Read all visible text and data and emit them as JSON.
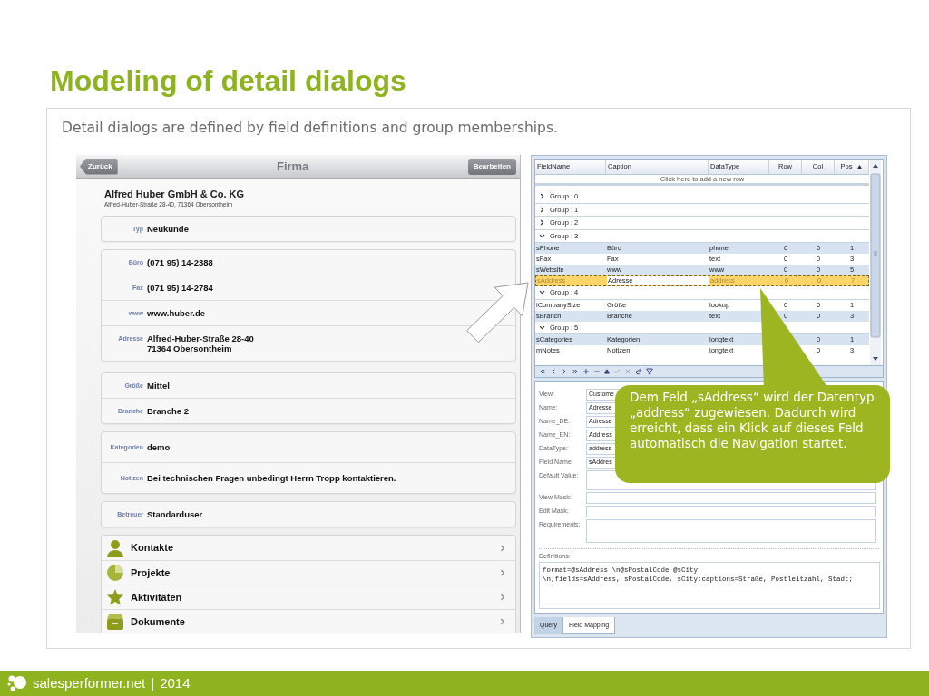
{
  "slide": {
    "title": "Modeling of detail dialogs",
    "subtitle": "Detail dialogs are defined by field definitions and group memberships."
  },
  "mobile": {
    "back": "Zurück",
    "title": "Firma",
    "edit": "Bearbeiten",
    "company": "Alfred Huber GmbH & Co. KG",
    "address": "Alfred-Huber-Straße 28-40, 71364 Obersontheim",
    "groups": [
      [
        {
          "label": "Typ",
          "value": "Neukunde"
        }
      ],
      [
        {
          "label": "Büro",
          "value": "(071 95) 14-2388"
        },
        {
          "label": "Fax",
          "value": "(071 95) 14-2784"
        },
        {
          "label": "www",
          "value": "www.huber.de"
        },
        {
          "label": "Adresse",
          "value": "Alfred-Huber-Straße 28-40\n71364 Obersontheim"
        }
      ],
      [
        {
          "label": "Größe",
          "value": "Mittel"
        },
        {
          "label": "Branche",
          "value": "Branche 2"
        }
      ],
      [
        {
          "label": "Kategorien",
          "value": "demo"
        },
        {
          "label": "Notizen",
          "value": "Bei technischen Fragen unbedingt Herrn Tropp kontaktieren."
        }
      ],
      [
        {
          "label": "Betreuer",
          "value": "Standarduser"
        }
      ]
    ],
    "links": [
      {
        "label": "Kontakte",
        "kind": "contacts"
      },
      {
        "label": "Projekte",
        "kind": "projects"
      },
      {
        "label": "Aktivitäten",
        "kind": "activities"
      },
      {
        "label": "Dokumente",
        "kind": "documents"
      }
    ]
  },
  "grid": {
    "columns": [
      {
        "label": "FieldName",
        "sorted": false
      },
      {
        "label": "Caption",
        "sorted": false
      },
      {
        "label": "DataType",
        "sorted": false
      },
      {
        "label": "Row",
        "sorted": false
      },
      {
        "label": "Col",
        "sorted": false
      },
      {
        "label": "Pos",
        "sorted": true
      }
    ],
    "new_row": "Click here to add a new row",
    "groups": [
      {
        "label": "Group : 0",
        "expanded": false
      },
      {
        "label": "Group : 1",
        "expanded": false
      },
      {
        "label": "Group : 2",
        "expanded": false
      },
      {
        "label": "Group : 3",
        "expanded": true,
        "children": [
          {
            "cells": [
              "sPhone",
              "Büro",
              "phone",
              "0",
              "0",
              "1"
            ],
            "shaded": true,
            "selected": false
          },
          {
            "cells": [
              "sFax",
              "Fax",
              "text",
              "0",
              "0",
              "3"
            ],
            "shaded": false,
            "selected": false
          },
          {
            "cells": [
              "sWebsite",
              "www",
              "www",
              "0",
              "0",
              "5"
            ],
            "shaded": true,
            "selected": false
          },
          {
            "cells": [
              "sAddress",
              "Adresse",
              "address",
              "0",
              "0",
              "7"
            ],
            "shaded": false,
            "selected": true
          }
        ]
      },
      {
        "label": "Group : 4",
        "expanded": true,
        "children": [
          {
            "cells": [
              "iCompanySize",
              "Größe",
              "lookup",
              "0",
              "0",
              "1"
            ],
            "shaded": false,
            "selected": false
          },
          {
            "cells": [
              "sBranch",
              "Branche",
              "text",
              "0",
              "0",
              "3"
            ],
            "shaded": true,
            "selected": false
          }
        ]
      },
      {
        "label": "Group : 5",
        "expanded": true,
        "children": [
          {
            "cells": [
              "sCategories",
              "Kategorien",
              "longtext",
              null,
              "0",
              "1"
            ],
            "shaded": true,
            "selected": false
          },
          {
            "cells": [
              "mNotes",
              "Notizen",
              "longtext",
              null,
              "0",
              "3"
            ],
            "shaded": false,
            "selected": false
          }
        ]
      }
    ]
  },
  "form": {
    "fields": [
      {
        "label": "View:",
        "kind": "text",
        "value": "Custome"
      },
      {
        "label": "Name:",
        "kind": "text",
        "value": "Adresse"
      },
      {
        "label": "Name_DE:",
        "kind": "text",
        "value": "Adresse"
      },
      {
        "label": "Name_EN:",
        "kind": "text",
        "value": "Address"
      },
      {
        "label": "DataType:",
        "kind": "combo",
        "value": "address"
      },
      {
        "label": "Field Name:",
        "kind": "text",
        "value": "sAddres"
      },
      {
        "label": "Default Value:",
        "kind": "area"
      },
      {
        "label": "View Mask:",
        "kind": "text"
      },
      {
        "label": "Edit Mask:",
        "kind": "text"
      },
      {
        "label": "Requirements:",
        "kind": "area"
      }
    ],
    "definitions": {
      "label": "Definitions:",
      "lines": [
        "format=@sAddress \\n@sPostalCode @sCity",
        "\\n;fields=sAddress, sPostalCode, sCity;captions=Straße, Postleitzahl, Stadt;"
      ]
    }
  },
  "tabs": [
    {
      "label": "Query",
      "selected": false
    },
    {
      "label": "Field Mapping",
      "selected": true
    }
  ],
  "callout": "Dem Feld „sAddress“ wird der Datentyp „address“ zugewiesen. Dadurch wird erreicht, dass ein Klick auf dieses Feld automatisch die Navigation startet.",
  "footer": {
    "site": "salesperformer.net",
    "separator": "|",
    "year": "2014"
  }
}
